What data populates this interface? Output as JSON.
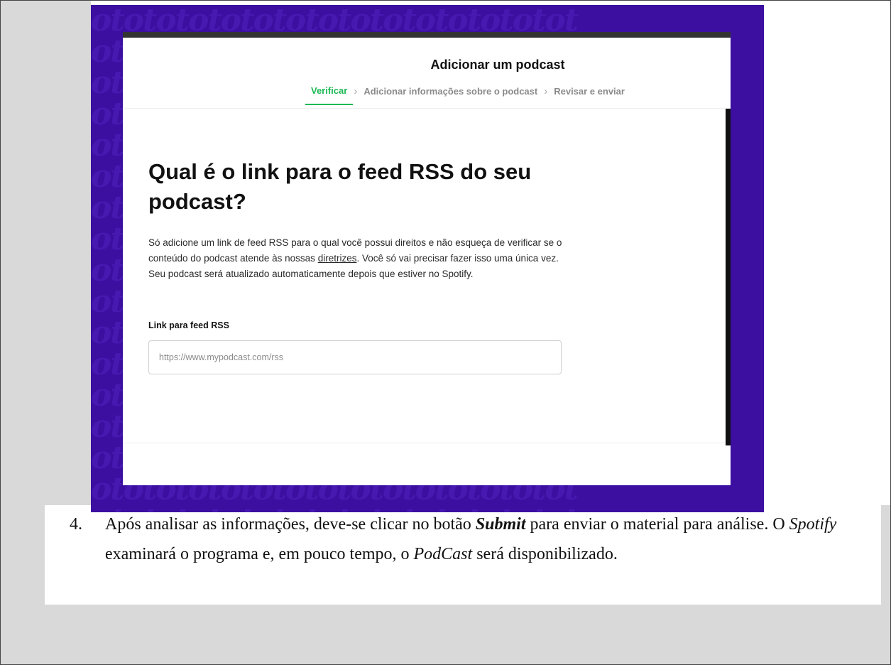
{
  "screenshot": {
    "title": "Adicionar um podcast",
    "steps": [
      {
        "label": "Verificar",
        "active": true
      },
      {
        "label": "Adicionar informações sobre o podcast",
        "active": false
      },
      {
        "label": "Revisar e enviar",
        "active": false
      }
    ],
    "heading": "Qual é o link para o feed RSS do seu podcast?",
    "description_before_link": "Só adicione um link de feed RSS para o qual você possui direitos e não esqueça de verificar se o conteúdo do podcast atende às nossas ",
    "description_link": "diretrizes",
    "description_after_link": ". Você só vai precisar fazer isso uma única vez. Seu podcast será atualizado automaticamente depois que estiver no Spotify.",
    "field_label": "Link para feed RSS",
    "field_placeholder": "https://www.mypodcast.com/rss",
    "accent_color": "#1db954",
    "background_color": "#3c0fa0"
  },
  "document": {
    "item_number": "4.",
    "text_1": "Após analisar as informações, deve-se clicar no botão ",
    "text_bold_italic": "Submit",
    "text_2": " para enviar o material para análise. O ",
    "text_italic_1": "Spotify",
    "text_3": " examinará o programa e, em pouco tempo, o ",
    "text_italic_2": "PodCast",
    "text_4": " será disponibilizado."
  }
}
